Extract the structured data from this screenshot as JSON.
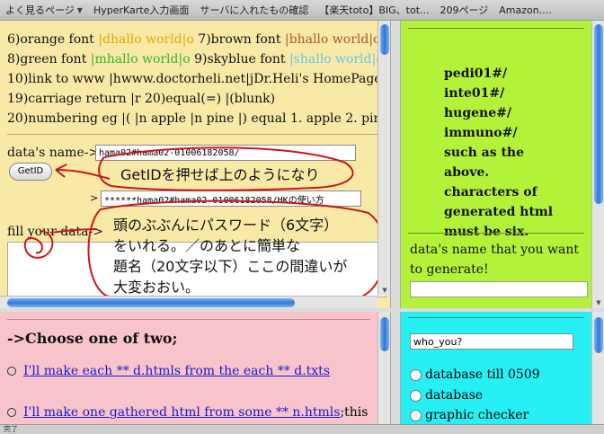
{
  "bookmarks": [
    {
      "label": "よく見るページ",
      "menu": true
    },
    {
      "label": "HyperKarte入力画面",
      "menu": false
    },
    {
      "label": "サーバに入れたもの確認",
      "menu": false
    },
    {
      "label": "【楽天toto】BIG、tot...",
      "menu": false
    },
    {
      "label": "209ページ",
      "menu": false
    },
    {
      "label": "Amazon....",
      "menu": false
    }
  ],
  "top_left": {
    "line1": {
      "a": "6)orange font ",
      "b": "|dhallo world|o",
      "c": " 7)brown font ",
      "d": "|bhallo world|o"
    },
    "line2": {
      "a": "8)green font ",
      "b": "|mhallo world|o",
      "c": " 9)skyblue font ",
      "d": "|shallo world|o"
    },
    "line3": "10)link to www |hwww.doctorheli.net|jDr.Heli's HomePage!|k",
    "line4": "19)carriage return |r 20)equal(=) |(blunk)",
    "line5": "20)numbering eg |( |n apple |n pine |) equal 1. apple 2. pine",
    "data_name_label": "data's name->",
    "data_name_value": "hama02#hama02-01006182058/",
    "getid_button": "GetID",
    "result_arrow": ">",
    "result_value": "******hama02#hama02-01006182058/HKの使い方",
    "fill_label": "fill your data->",
    "note1": "GetIDを押せば上のようになり",
    "note2": [
      "頭のぶぶんにパスワード（6文字）",
      "をいれる。／のあとに簡単な",
      "題名（20文字以下）ここの間違いが",
      "大変おおい。"
    ]
  },
  "top_right": {
    "items": [
      "pedi01#/",
      "inte01#/",
      "hugene#/",
      "immuno#/",
      "such as the",
      "above.",
      "characters of",
      "generated html",
      "must be six."
    ],
    "generate_label": "data's name that you want to generate!"
  },
  "bottom_left": {
    "heading": "->Choose one of two;",
    "options": [
      {
        "link": "I'll make each ** d.htmls from the each ** d.txts",
        "tail": ""
      },
      {
        "link": "I'll make one gathered html from some ** n.htmls",
        "tail": ";this"
      }
    ]
  },
  "bottom_right": {
    "input_value": "who_you?",
    "radios": [
      "database till 0509",
      "database",
      "graphic checker"
    ]
  },
  "status_text": "完了",
  "colors": {
    "yellow_pane": "#f8e9a7",
    "green_pane": "#b4f23a",
    "pink_pane": "#f7c4cc",
    "cyan_pane": "#27f0f5",
    "annotation_red": "#c81818"
  }
}
